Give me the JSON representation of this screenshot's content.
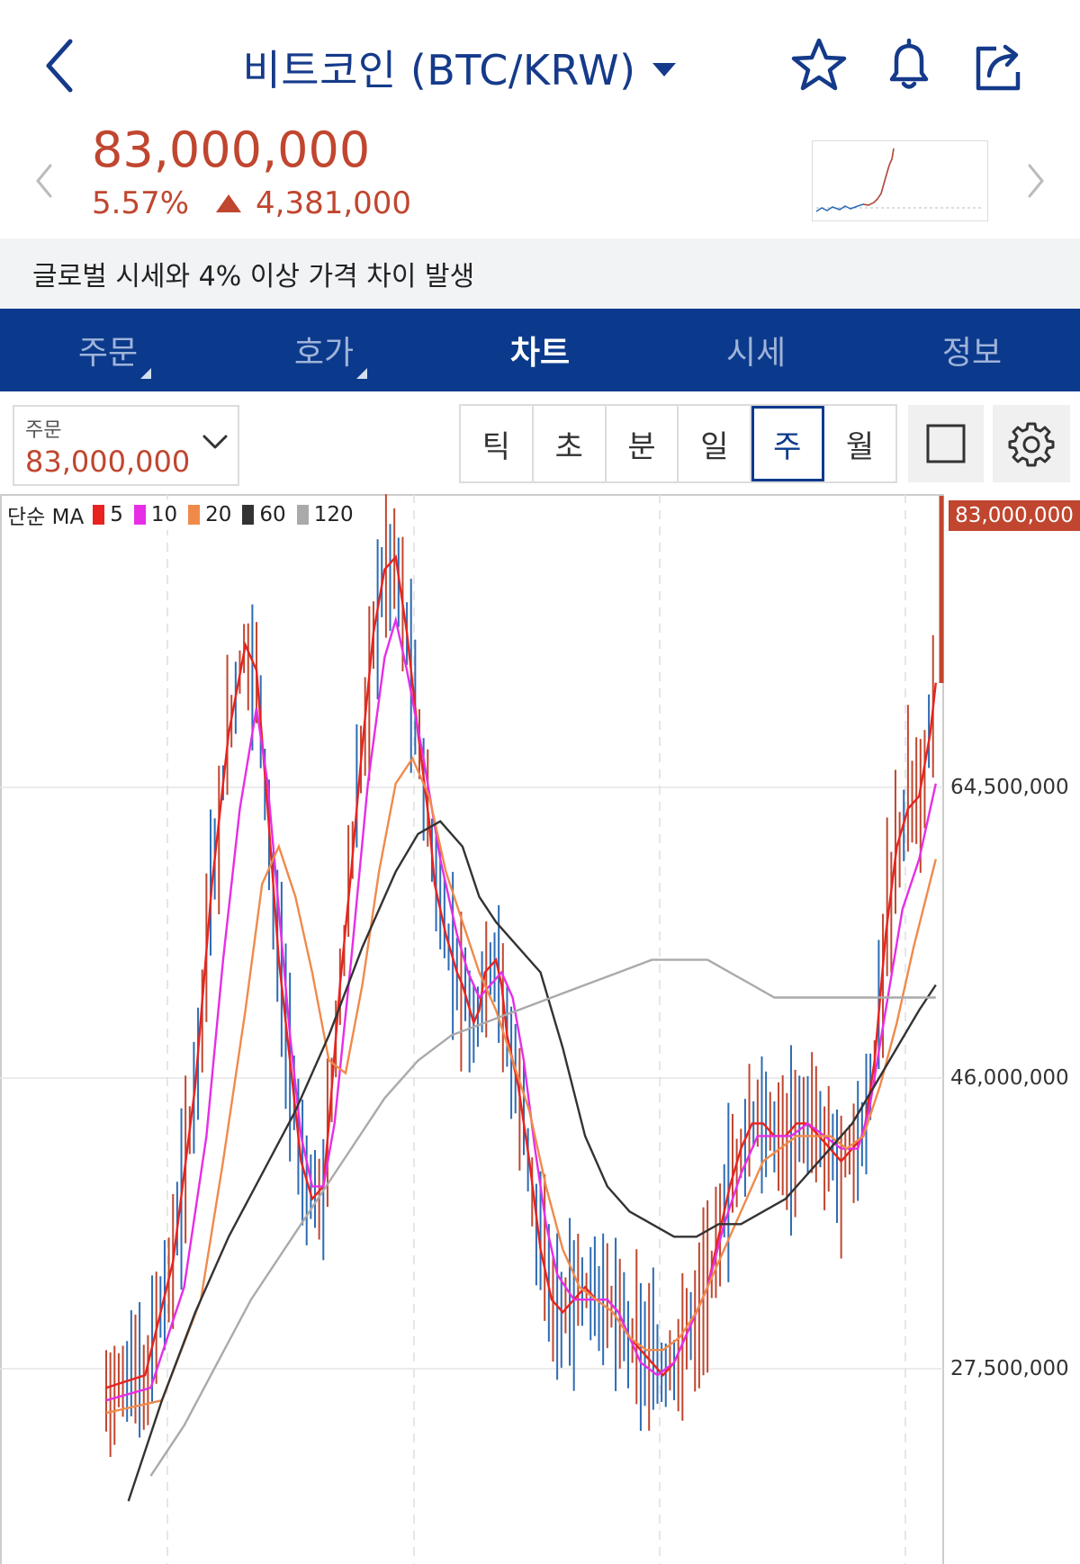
{
  "header": {
    "title": "비트코인 (BTC/KRW)"
  },
  "price": {
    "current": "83,000,000",
    "change_pct": "5.57%",
    "change_amount": "4,381,000"
  },
  "notice": "글로벌 시세와 4% 이상 가격 차이 발생",
  "tabs": [
    {
      "label": "주문"
    },
    {
      "label": "호가"
    },
    {
      "label": "차트"
    },
    {
      "label": "시세"
    },
    {
      "label": "정보"
    }
  ],
  "order_box": {
    "label": "주문",
    "value": "83,000,000"
  },
  "periods": [
    "틱",
    "초",
    "분",
    "일",
    "주",
    "월"
  ],
  "active_period": "주",
  "legend": {
    "title": "단순 MA",
    "items": [
      {
        "name": "5",
        "color": "#e8231f"
      },
      {
        "name": "10",
        "color": "#e62ee6"
      },
      {
        "name": "20",
        "color": "#f08a4b"
      },
      {
        "name": "60",
        "color": "#333333"
      },
      {
        "name": "120",
        "color": "#aaaaaa"
      }
    ]
  },
  "colors": {
    "accent": "#0b3a8c",
    "up": "#c0462f",
    "down": "#2d6bb3"
  },
  "chart_data": {
    "type": "line",
    "yaxis_labels": [
      "83,000,000",
      "64,500,000",
      "46,000,000",
      "27,500,000"
    ],
    "current_price_label": "83,000,000",
    "series": [
      {
        "name": "5",
        "points": [
          [
            0,
            14
          ],
          [
            7,
            15
          ],
          [
            12,
            24
          ],
          [
            16,
            38
          ],
          [
            19,
            54
          ],
          [
            22,
            66
          ],
          [
            25,
            73
          ],
          [
            27,
            71
          ],
          [
            29,
            60
          ],
          [
            31,
            48
          ],
          [
            33,
            40
          ],
          [
            35,
            32
          ],
          [
            37,
            29
          ],
          [
            39,
            30
          ],
          [
            40,
            35
          ],
          [
            42,
            46
          ],
          [
            44,
            55
          ],
          [
            46,
            65
          ],
          [
            48,
            74
          ],
          [
            50,
            79
          ],
          [
            52,
            80
          ],
          [
            54,
            74
          ],
          [
            56,
            66
          ],
          [
            58,
            59
          ],
          [
            59,
            54
          ],
          [
            61,
            50
          ],
          [
            63,
            47
          ],
          [
            64,
            46
          ],
          [
            66,
            43
          ],
          [
            67,
            44
          ],
          [
            68,
            47
          ],
          [
            70,
            48
          ],
          [
            71,
            46
          ],
          [
            72,
            42
          ],
          [
            74,
            38
          ],
          [
            76,
            32
          ],
          [
            78,
            25
          ],
          [
            80,
            21
          ],
          [
            82,
            20
          ],
          [
            84,
            21
          ],
          [
            86,
            22
          ],
          [
            88,
            21
          ],
          [
            90,
            21
          ],
          [
            92,
            20
          ],
          [
            94,
            18
          ],
          [
            96,
            17
          ],
          [
            98,
            16
          ],
          [
            100,
            15
          ],
          [
            102,
            16
          ],
          [
            104,
            18
          ],
          [
            106,
            20
          ],
          [
            108,
            22
          ],
          [
            110,
            26
          ],
          [
            112,
            30
          ],
          [
            114,
            33
          ],
          [
            116,
            35
          ],
          [
            118,
            35
          ],
          [
            120,
            34
          ],
          [
            122,
            34
          ],
          [
            124,
            35
          ],
          [
            126,
            35
          ],
          [
            128,
            34
          ],
          [
            130,
            33
          ],
          [
            132,
            32
          ],
          [
            134,
            33
          ],
          [
            136,
            34
          ],
          [
            138,
            40
          ],
          [
            140,
            50
          ],
          [
            142,
            57
          ],
          [
            144,
            60
          ],
          [
            146,
            61
          ],
          [
            148,
            66
          ],
          [
            149,
            70
          ]
        ]
      },
      {
        "name": "10",
        "points": [
          [
            0,
            13
          ],
          [
            8,
            14
          ],
          [
            14,
            22
          ],
          [
            18,
            34
          ],
          [
            21,
            48
          ],
          [
            24,
            60
          ],
          [
            27,
            68
          ],
          [
            29,
            62
          ],
          [
            31,
            52
          ],
          [
            33,
            42
          ],
          [
            35,
            34
          ],
          [
            37,
            30
          ],
          [
            39,
            30
          ],
          [
            41,
            35
          ],
          [
            44,
            48
          ],
          [
            47,
            62
          ],
          [
            50,
            72
          ],
          [
            52,
            75
          ],
          [
            54,
            71
          ],
          [
            57,
            64
          ],
          [
            60,
            56
          ],
          [
            63,
            50
          ],
          [
            65,
            47
          ],
          [
            67,
            45
          ],
          [
            69,
            46
          ],
          [
            71,
            47
          ],
          [
            73,
            45
          ],
          [
            75,
            40
          ],
          [
            77,
            33
          ],
          [
            79,
            27
          ],
          [
            81,
            23
          ],
          [
            84,
            21
          ],
          [
            87,
            21
          ],
          [
            90,
            21
          ],
          [
            92,
            20
          ],
          [
            94,
            18
          ],
          [
            96,
            16
          ],
          [
            99,
            15
          ],
          [
            102,
            16
          ],
          [
            105,
            19
          ],
          [
            108,
            22
          ],
          [
            111,
            27
          ],
          [
            114,
            31
          ],
          [
            117,
            34
          ],
          [
            120,
            34
          ],
          [
            123,
            34
          ],
          [
            126,
            35
          ],
          [
            129,
            34
          ],
          [
            132,
            33
          ],
          [
            135,
            33
          ],
          [
            137,
            36
          ],
          [
            140,
            44
          ],
          [
            143,
            52
          ],
          [
            146,
            56
          ],
          [
            149,
            62
          ]
        ]
      },
      {
        "name": "20",
        "points": [
          [
            0,
            12
          ],
          [
            10,
            13
          ],
          [
            17,
            21
          ],
          [
            21,
            32
          ],
          [
            25,
            44
          ],
          [
            28,
            54
          ],
          [
            31,
            57
          ],
          [
            34,
            53
          ],
          [
            37,
            47
          ],
          [
            40,
            40
          ],
          [
            43,
            39
          ],
          [
            46,
            46
          ],
          [
            49,
            55
          ],
          [
            52,
            62
          ],
          [
            55,
            64
          ],
          [
            58,
            61
          ],
          [
            61,
            55
          ],
          [
            64,
            51
          ],
          [
            67,
            47
          ],
          [
            70,
            44
          ],
          [
            73,
            40
          ],
          [
            76,
            36
          ],
          [
            79,
            30
          ],
          [
            82,
            25
          ],
          [
            85,
            22
          ],
          [
            88,
            21
          ],
          [
            91,
            20
          ],
          [
            94,
            18
          ],
          [
            97,
            17
          ],
          [
            100,
            17
          ],
          [
            103,
            18
          ],
          [
            106,
            20
          ],
          [
            109,
            23
          ],
          [
            112,
            26
          ],
          [
            115,
            29
          ],
          [
            118,
            32
          ],
          [
            121,
            33
          ],
          [
            124,
            34
          ],
          [
            127,
            34
          ],
          [
            130,
            34
          ],
          [
            133,
            33
          ],
          [
            136,
            34
          ],
          [
            139,
            38
          ],
          [
            142,
            43
          ],
          [
            145,
            49
          ],
          [
            149,
            56
          ]
        ]
      },
      {
        "name": "60",
        "points": [
          [
            4,
            5
          ],
          [
            10,
            13
          ],
          [
            16,
            20
          ],
          [
            22,
            26
          ],
          [
            28,
            31
          ],
          [
            34,
            36
          ],
          [
            40,
            42
          ],
          [
            46,
            49
          ],
          [
            52,
            55
          ],
          [
            56,
            58
          ],
          [
            60,
            59
          ],
          [
            64,
            57
          ],
          [
            67,
            53
          ],
          [
            70,
            51
          ],
          [
            74,
            49
          ],
          [
            78,
            47
          ],
          [
            82,
            41
          ],
          [
            86,
            34
          ],
          [
            90,
            30
          ],
          [
            94,
            28
          ],
          [
            98,
            27
          ],
          [
            102,
            26
          ],
          [
            106,
            26
          ],
          [
            110,
            27
          ],
          [
            114,
            27
          ],
          [
            118,
            28
          ],
          [
            122,
            29
          ],
          [
            126,
            31
          ],
          [
            130,
            33
          ],
          [
            134,
            35
          ],
          [
            138,
            38
          ],
          [
            142,
            41
          ],
          [
            146,
            44
          ],
          [
            149,
            46
          ]
        ]
      },
      {
        "name": "120",
        "points": [
          [
            8,
            7
          ],
          [
            14,
            11
          ],
          [
            20,
            16
          ],
          [
            26,
            21
          ],
          [
            32,
            25
          ],
          [
            38,
            29
          ],
          [
            44,
            33
          ],
          [
            50,
            37
          ],
          [
            56,
            40
          ],
          [
            62,
            42
          ],
          [
            68,
            43
          ],
          [
            74,
            44
          ],
          [
            80,
            45
          ],
          [
            86,
            46
          ],
          [
            92,
            47
          ],
          [
            98,
            48
          ],
          [
            104,
            48
          ],
          [
            108,
            48
          ],
          [
            112,
            47
          ],
          [
            116,
            46
          ],
          [
            120,
            45
          ],
          [
            126,
            45
          ],
          [
            132,
            45
          ],
          [
            138,
            45
          ],
          [
            144,
            45
          ],
          [
            149,
            45
          ]
        ]
      }
    ]
  }
}
